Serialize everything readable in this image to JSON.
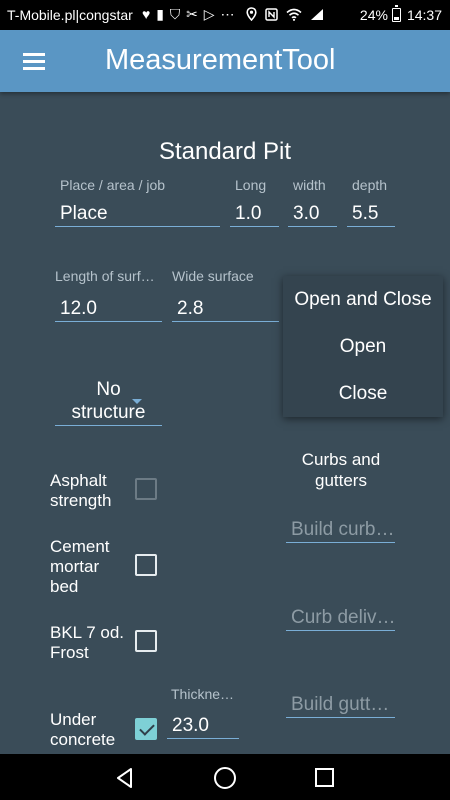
{
  "status_bar": {
    "carrier": "T-Mobile.pl|congstar",
    "icons": [
      "heartbeat-icon",
      "lock-icon",
      "shield-icon",
      "wrench-icon",
      "play-icon",
      "more-icon",
      "location-icon",
      "nfc-icon",
      "wifi-icon",
      "signal-icon"
    ],
    "icon_glyphs": "♥ ▮ ⛉ ✂ ▷ ⋯",
    "battery": "24%",
    "time": "14:37"
  },
  "app_bar": {
    "title": "MeasurementTool",
    "menu_icon": "hamburger-menu-icon"
  },
  "form": {
    "section_title": "Standard Pit",
    "place": {
      "label": "Place / area / job",
      "value": "Place"
    },
    "long": {
      "label": "Long",
      "value": "1.0"
    },
    "width": {
      "label": "width",
      "value": "3.0"
    },
    "depth": {
      "label": "depth",
      "value": "5.5"
    },
    "length_surface": {
      "label": "Length of surf…",
      "value": "12.0"
    },
    "wide_surface": {
      "label": "Wide surface",
      "value": "2.8"
    },
    "structure_spinner": {
      "line1": "No",
      "line2": "structure"
    },
    "dropdown_options": [
      "Open and Close",
      "Open",
      "Close"
    ]
  },
  "checkboxes": [
    {
      "line1": "Asphalt",
      "line2": "strength",
      "line3": "",
      "checked": false,
      "enabled": false
    },
    {
      "line1": "Cement",
      "line2": "mortar",
      "line3": "bed",
      "checked": false,
      "enabled": true
    },
    {
      "line1": "BKL 7 od.",
      "line2": "Frost",
      "line3": "",
      "checked": false,
      "enabled": true
    },
    {
      "line1": "Under",
      "line2": "concrete",
      "line3": "",
      "checked": true,
      "enabled": true
    }
  ],
  "thickness": {
    "label": "Thickne…",
    "value": "23.0"
  },
  "curbs": {
    "header_line1": "Curbs and",
    "header_line2": "gutters",
    "build_curb_hint": "Build curb…",
    "curb_delivery_hint": "Curb deliv…",
    "build_gutter_hint": "Build gutt…"
  },
  "colors": {
    "app_bar": "#5a96c4",
    "background": "#3a4c58",
    "accent_underline": "#7aaed6",
    "checkbox_checked": "#7ed0d6",
    "popup": "#34444f"
  },
  "nav_bar": {
    "back": "back-triangle-icon",
    "home": "home-circle-icon",
    "recent": "recent-square-icon"
  }
}
